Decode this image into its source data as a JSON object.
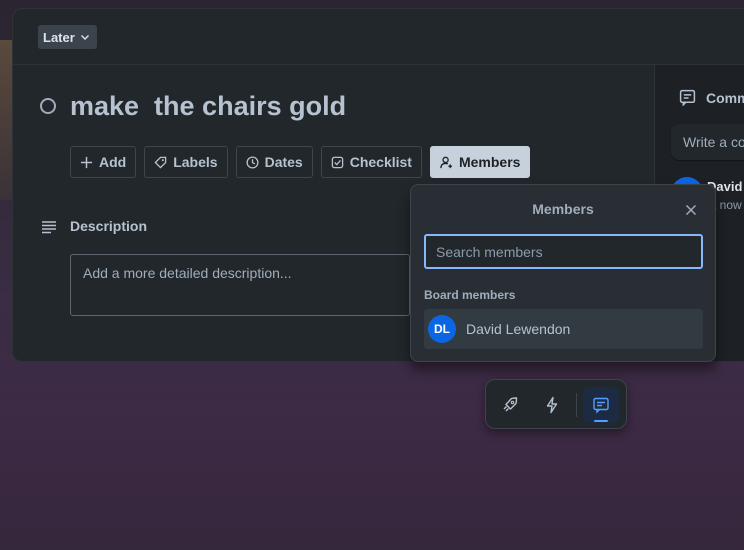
{
  "list": {
    "label": "Later"
  },
  "card": {
    "title": "make  the chairs gold"
  },
  "actions": [
    {
      "label": "Add",
      "icon": "plus-icon"
    },
    {
      "label": "Labels",
      "icon": "tag-icon"
    },
    {
      "label": "Dates",
      "icon": "clock-icon"
    },
    {
      "label": "Checklist",
      "icon": "checkbox-icon"
    },
    {
      "label": "Members",
      "icon": "add-user-icon"
    }
  ],
  "description": {
    "title": "Description",
    "placeholder": "Add a more detailed description..."
  },
  "comments": {
    "title": "Comm",
    "input_placeholder": "Write a co",
    "activity_name": "David",
    "activity_time": "st now"
  },
  "members_popover": {
    "title": "Members",
    "search_placeholder": "Search members",
    "section": "Board members",
    "members": [
      {
        "initials": "DL",
        "name": "David Lewendon"
      }
    ]
  },
  "bottom_bar": {
    "items": [
      "rocket-icon",
      "lightning-icon",
      "message-icon"
    ],
    "active": "message-icon"
  },
  "colors": {
    "accent": "#0c66e4",
    "focus": "#85b8ff",
    "active_button": "#c7d1db"
  }
}
